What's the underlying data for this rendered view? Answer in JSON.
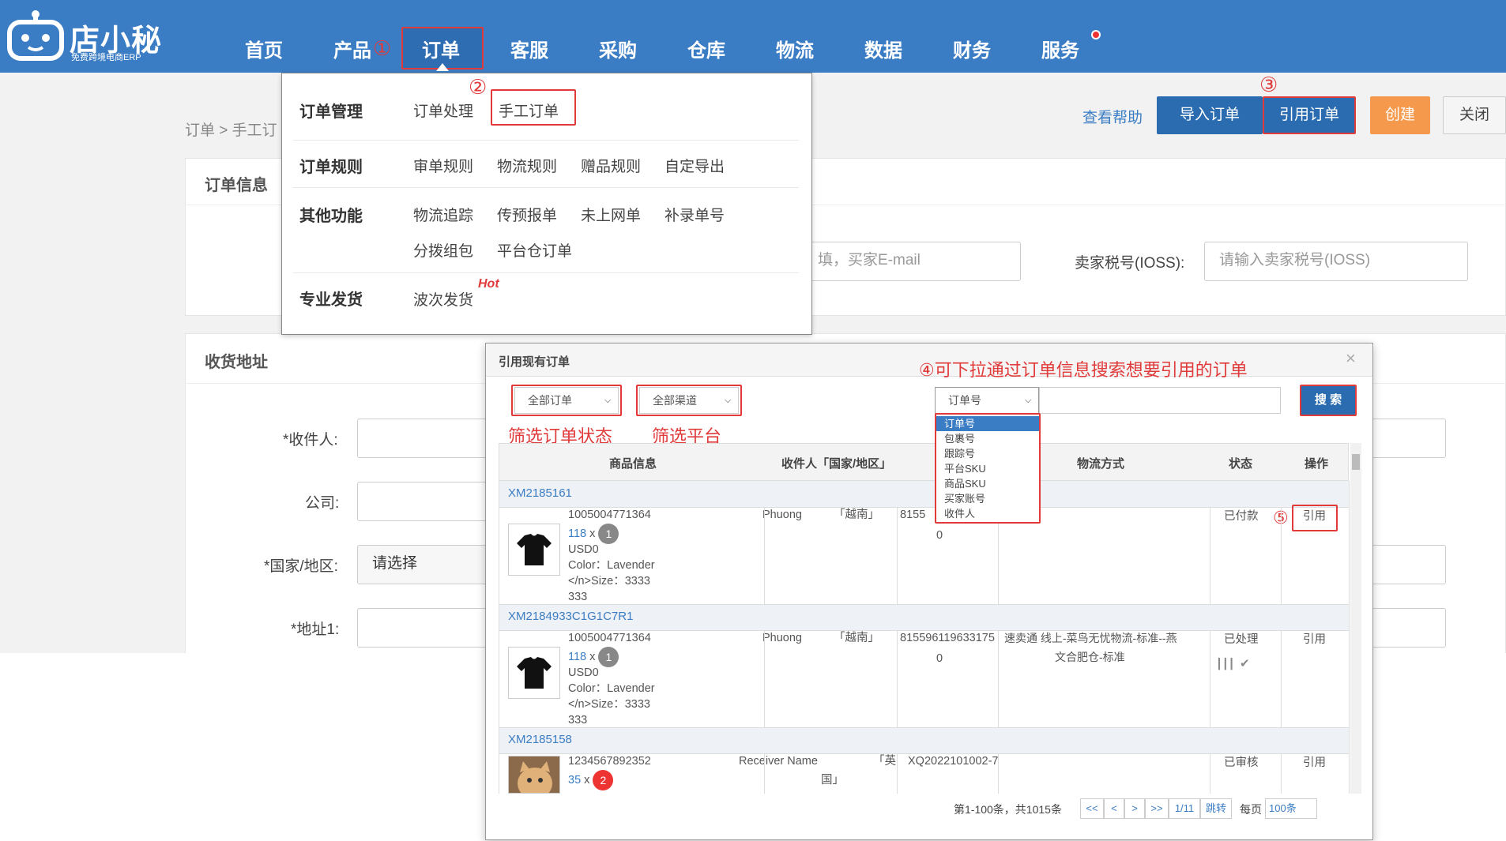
{
  "app": {
    "logo_text": "店小秘",
    "logo_sub": "免费跨境电商ERP"
  },
  "nav": [
    "首页",
    "产品",
    "订单",
    "客服",
    "采购",
    "仓库",
    "物流",
    "数据",
    "财务",
    "服务"
  ],
  "annotations": {
    "n1": "①",
    "n2": "②",
    "n3": "③",
    "n5": "⑤",
    "n4_text": "④可下拉通过订单信息搜索想要引用的订单",
    "filter_status": "筛选订单状态",
    "filter_platform": "筛选平台"
  },
  "breadcrumb": "订单 > 手工订",
  "toolbar": {
    "help": "查看帮助",
    "import": "导入订单",
    "cite": "引用订单",
    "create": "创建",
    "close": "关闭"
  },
  "sections": {
    "order_info": "订单信息",
    "address": "收货地址"
  },
  "form": {
    "email_placeholder": "填，买家E-mail",
    "ioss_label": "卖家税号(IOSS):",
    "ioss_placeholder": "请输入卖家税号(IOSS)",
    "receiver": "*收件人:",
    "company": "公司:",
    "country": "*国家/地区:",
    "country_value": "请选择",
    "address1": "*地址1:"
  },
  "menu": {
    "cat1": "订单管理",
    "i_process": "订单处理",
    "i_manual": "手工订单",
    "cat2": "订单规则",
    "i_review": "审单规则",
    "i_logistics": "物流规则",
    "i_gift": "赠品规则",
    "i_export": "自定导出",
    "cat3": "其他功能",
    "i_track": "物流追踪",
    "i_pre": "传预报单",
    "i_notonline": "未上网单",
    "i_supp": "补录单号",
    "i_split": "分拨组包",
    "i_platwh": "平台仓订单",
    "cat4": "专业发货",
    "i_wave": "波次发货",
    "hot": "Hot"
  },
  "modal": {
    "title": "引用现有订单",
    "close": "×",
    "sel_status": "全部订单",
    "sel_channel": "全部渠道",
    "sel_field": "订单号",
    "search": "搜 索",
    "options": [
      "订单号",
      "包裹号",
      "跟踪号",
      "平台SKU",
      "商品SKU",
      "买家账号",
      "收件人"
    ],
    "headers": {
      "product": "商品信息",
      "receiver": "收件人「国家/地区」",
      "logistics": "物流方式",
      "status": "状态",
      "action": "操作"
    },
    "orders": [
      {
        "id": "XM2185161",
        "sku": "1005004771364",
        "qty": "118",
        "num": "1",
        "currency": "USD0",
        "color": "Color：Lavender",
        "size": "</n>Size：3333",
        "size2": "333",
        "receiver": "Phuong",
        "country": "「越南」",
        "track": "8155",
        "track2": "0",
        "logistics": "",
        "status": "已付款",
        "action": "引用"
      },
      {
        "id": "XM2184933C1G1C7R1",
        "sku": "1005004771364",
        "qty": "118",
        "num": "1",
        "currency": "USD0",
        "color": "Color：Lavender",
        "size": "</n>Size：3333",
        "size2": "333",
        "receiver": "Phuong",
        "country": "「越南」",
        "track": "815596119633175",
        "track2": "0",
        "logistics": "速卖通 线上-菜鸟无忧物流-标准--燕",
        "logistics2": "文合肥仓-标准",
        "status": "已处理",
        "action": "引用"
      },
      {
        "id": "XM2185158",
        "sku": "1234567892352",
        "qty": "35",
        "num": "2",
        "receiver": "Receiver Name",
        "country": "「英",
        "country2": "国」",
        "track": "XQ2022101002-7",
        "status": "已审核",
        "action": "引用"
      }
    ],
    "pager": {
      "info": "第1-100条，共1015条",
      "first": "<<",
      "prev": "<",
      "next": ">",
      "last": ">>",
      "page": "1/11",
      "jump": "跳转",
      "per": "每页",
      "size": "100条"
    }
  }
}
